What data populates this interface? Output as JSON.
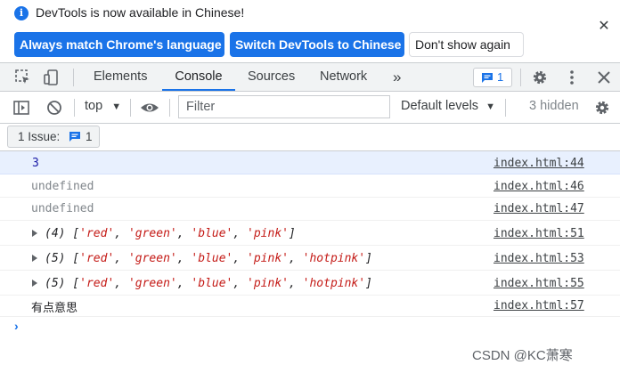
{
  "infobar": {
    "icon": "info-icon",
    "message": "DevTools is now available in Chinese!",
    "buttons": {
      "match": "Always match Chrome's language",
      "switch": "Switch DevTools to Chinese",
      "dont_show": "Don't show again"
    },
    "close": "✕"
  },
  "tabs": {
    "elements": "Elements",
    "console": "Console",
    "sources": "Sources",
    "network": "Network",
    "more": "»",
    "issues_count": "1",
    "active": "console"
  },
  "toolbar": {
    "context": "top",
    "filter_placeholder": "Filter",
    "levels": "Default levels",
    "hidden": "3 hidden"
  },
  "issues_bar": {
    "label": "1 Issue:",
    "count": "1"
  },
  "console_rows": [
    {
      "text": "3",
      "source": "index.html:44",
      "kind": "number",
      "selected": true
    },
    {
      "text": "undefined",
      "source": "index.html:46",
      "kind": "undefined"
    },
    {
      "text": "undefined",
      "source": "index.html:47",
      "kind": "undefined"
    },
    {
      "length": "(4)",
      "items": [
        "'red'",
        "'green'",
        "'blue'",
        "'pink'"
      ],
      "source": "index.html:51",
      "kind": "array"
    },
    {
      "length": "(5)",
      "items": [
        "'red'",
        "'green'",
        "'blue'",
        "'pink'",
        "'hotpink'"
      ],
      "source": "index.html:53",
      "kind": "array"
    },
    {
      "length": "(5)",
      "items": [
        "'red'",
        "'green'",
        "'blue'",
        "'pink'",
        "'hotpink'"
      ],
      "source": "index.html:55",
      "kind": "array"
    },
    {
      "text": "有点意思",
      "source": "index.html:57",
      "kind": "text"
    }
  ],
  "prompt": "›",
  "watermark": "CSDN @KC萧寒",
  "colors": {
    "accent": "#1a73e8",
    "string": "#c41a16",
    "number": "#1a1aa6",
    "selected_row": "#e8f0fe"
  }
}
